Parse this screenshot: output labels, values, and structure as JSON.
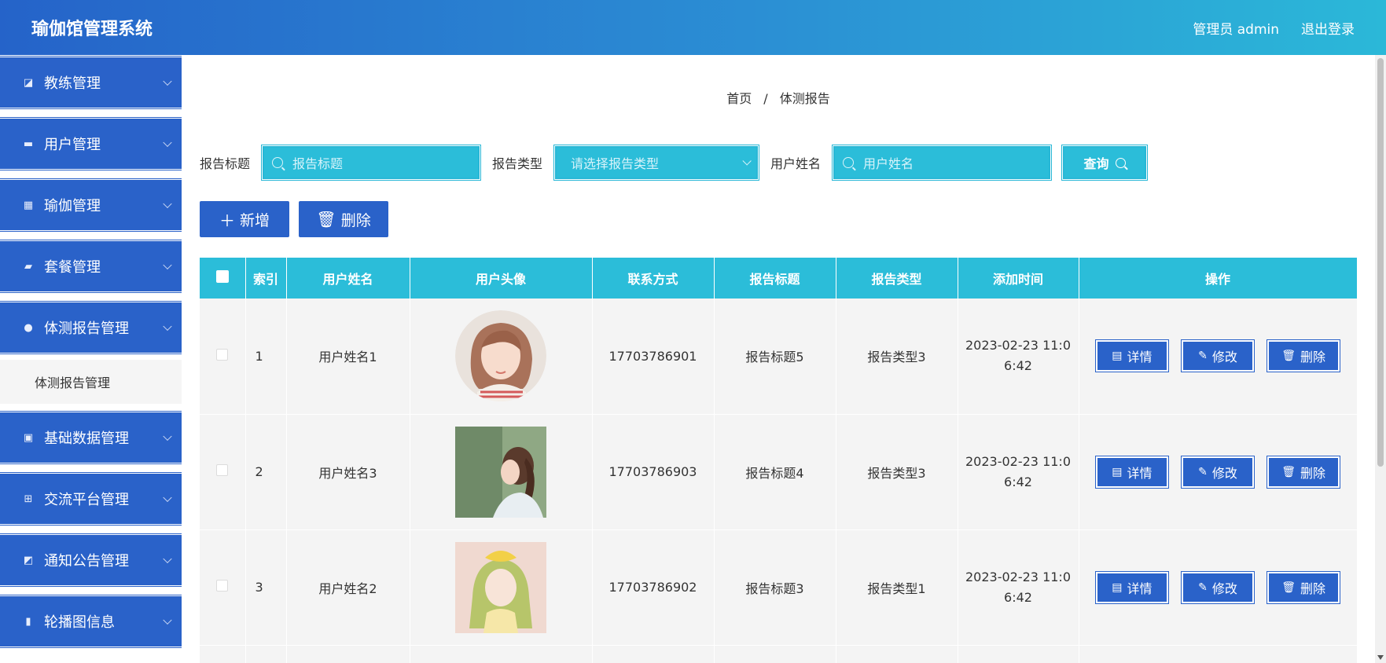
{
  "header": {
    "app_title": "瑜伽馆管理系统",
    "admin_label": "管理员 admin",
    "logout_label": "退出登录"
  },
  "sidebar": {
    "items": [
      {
        "label": "教练管理",
        "icon": "chart-icon"
      },
      {
        "label": "用户管理",
        "icon": "monitor-icon"
      },
      {
        "label": "瑜伽管理",
        "icon": "grid-icon"
      },
      {
        "label": "套餐管理",
        "icon": "ticket-icon"
      },
      {
        "label": "体测报告管理",
        "icon": "user-icon"
      },
      {
        "label": "基础数据管理",
        "icon": "clipboard-icon"
      },
      {
        "label": "交流平台管理",
        "icon": "apps-icon"
      },
      {
        "label": "通知公告管理",
        "icon": "notice-icon"
      },
      {
        "label": "轮播图信息",
        "icon": "bar-chart-icon"
      }
    ],
    "submenu_label": "体测报告管理"
  },
  "breadcrumb": {
    "home": "首页",
    "separator": "/",
    "current": "体测报告"
  },
  "search": {
    "title_label": "报告标题",
    "title_placeholder": "报告标题",
    "type_label": "报告类型",
    "type_placeholder": "请选择报告类型",
    "name_label": "用户姓名",
    "name_placeholder": "用户姓名",
    "query_label": "查询"
  },
  "actions": {
    "add_label": "新增",
    "delete_label": "删除"
  },
  "table": {
    "headers": [
      "索引",
      "用户姓名",
      "用户头像",
      "联系方式",
      "报告标题",
      "报告类型",
      "添加时间",
      "操作"
    ],
    "rows": [
      {
        "index": "1",
        "name": "用户姓名1",
        "phone": "17703786901",
        "title": "报告标题5",
        "type": "报告类型3",
        "time_line1": "2023-02-23 11:0",
        "time_line2": "6:42"
      },
      {
        "index": "2",
        "name": "用户姓名3",
        "phone": "17703786903",
        "title": "报告标题4",
        "type": "报告类型3",
        "time_line1": "2023-02-23 11:0",
        "time_line2": "6:42"
      },
      {
        "index": "3",
        "name": "用户姓名2",
        "phone": "17703786902",
        "title": "报告标题3",
        "type": "报告类型1",
        "time_line1": "2023-02-23 11:0",
        "time_line2": "6:42"
      }
    ],
    "op_detail": "详情",
    "op_edit": "修改",
    "op_delete": "删除"
  },
  "colors": {
    "primary": "#2a62c9",
    "accent": "#2bbdd9"
  }
}
